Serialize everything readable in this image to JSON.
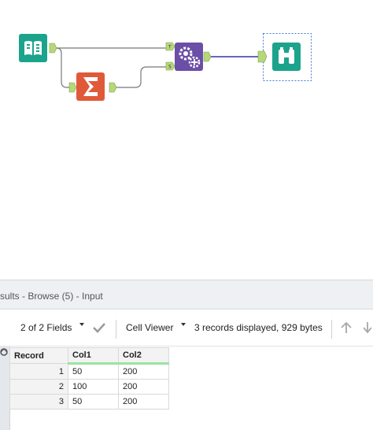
{
  "canvas": {
    "tools": [
      {
        "name": "Input Data",
        "icon": "book-icon",
        "color": "#1ba38c"
      },
      {
        "name": "Summarize",
        "icon": "sigma-icon",
        "color": "#e05a3a"
      },
      {
        "name": "Append Fields",
        "icon": "gears-icon",
        "color": "#6b4ea6"
      },
      {
        "name": "Browse",
        "icon": "binoculars-icon",
        "color": "#1ba38c"
      }
    ],
    "anchors": {
      "target": "T",
      "source": "S"
    },
    "connection_color": "#3333aa"
  },
  "results": {
    "title": "sults - Browse (5) - Input",
    "fields_label": "2 of 2 Fields",
    "viewer_label": "Cell Viewer",
    "records_info": "3 records displayed, 929 bytes",
    "columns": [
      "Record",
      "Col1",
      "Col2"
    ],
    "rows": [
      [
        "1",
        "50",
        "200"
      ],
      [
        "2",
        "100",
        "200"
      ],
      [
        "3",
        "50",
        "200"
      ]
    ]
  }
}
